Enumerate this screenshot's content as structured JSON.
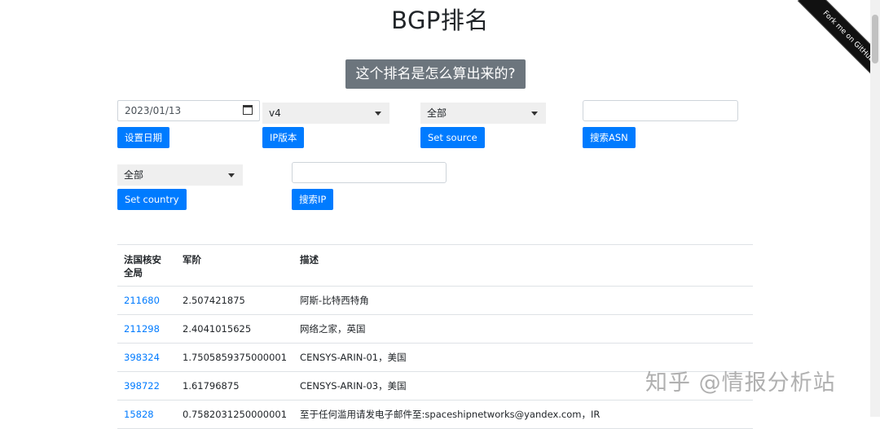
{
  "page": {
    "title": "BGP排名"
  },
  "explain_button": "这个排名是怎么算出来的?",
  "ribbon": "Fork me on GitHub",
  "controls": {
    "date_value": "2023/01/13",
    "set_date_label": "设置日期",
    "ip_version_selected": "v4",
    "ip_version_label": "IP版本",
    "source_selected": "全部",
    "set_source_label": "Set source",
    "asn_search_value": "",
    "search_asn_label": "搜索ASN",
    "country_selected": "全部",
    "set_country_label": "Set country",
    "ip_search_value": "",
    "search_ip_label": "搜索IP"
  },
  "table": {
    "headers": [
      "法国核安全局",
      "军阶",
      "描述"
    ],
    "rows": [
      {
        "asn": "211680",
        "rank": "2.507421875",
        "desc": "阿斯-比特西特角"
      },
      {
        "asn": "211298",
        "rank": "2.4041015625",
        "desc": "网络之家，英国"
      },
      {
        "asn": "398324",
        "rank": "1.7505859375000001",
        "desc": "CENSYS-ARIN-01，美国"
      },
      {
        "asn": "398722",
        "rank": "1.61796875",
        "desc": "CENSYS-ARIN-03，美国"
      },
      {
        "asn": "15828",
        "rank": "0.7582031250000001",
        "desc": "至于任何滥用请发电子邮件至:spaceshipnetworks@yandex.com，IR"
      }
    ]
  },
  "watermark": "知乎 @情报分析站",
  "colors": {
    "primary": "#007bff",
    "secondary": "#6c757d"
  }
}
